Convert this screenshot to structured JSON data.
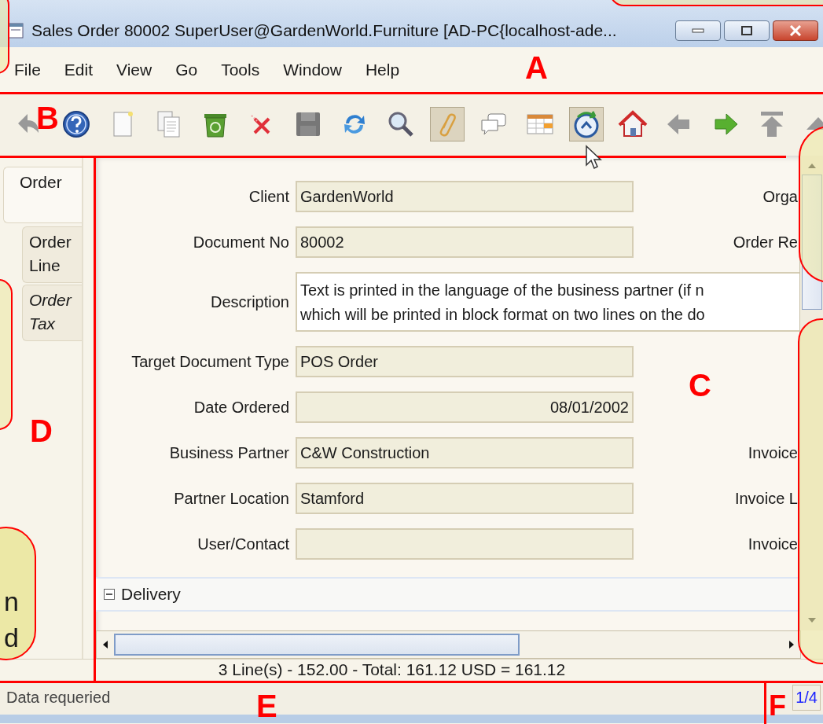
{
  "window": {
    "title": "Sales Order  80002  SuperUser@GardenWorld.Furniture [AD-PC{localhost-ade..."
  },
  "menu": [
    {
      "label": "File"
    },
    {
      "label": "Edit"
    },
    {
      "label": "View"
    },
    {
      "label": "Go"
    },
    {
      "label": "Tools"
    },
    {
      "label": "Window"
    },
    {
      "label": "Help"
    }
  ],
  "toolbar": [
    {
      "kind": "back",
      "pressed": false
    },
    {
      "kind": "help",
      "pressed": false
    },
    {
      "kind": "new",
      "pressed": false
    },
    {
      "kind": "copy",
      "pressed": false
    },
    {
      "kind": "delete",
      "pressed": false
    },
    {
      "kind": "delete-selection",
      "pressed": false
    },
    {
      "kind": "save",
      "pressed": false
    },
    {
      "kind": "refresh",
      "pressed": false
    },
    {
      "kind": "find",
      "pressed": false
    },
    {
      "kind": "attachment",
      "pressed": true
    },
    {
      "kind": "chat",
      "pressed": false
    },
    {
      "kind": "grid",
      "pressed": false
    },
    {
      "kind": "history",
      "pressed": true
    },
    {
      "kind": "home",
      "pressed": false
    },
    {
      "kind": "previous",
      "pressed": false
    },
    {
      "kind": "next",
      "pressed": false
    },
    {
      "kind": "first",
      "pressed": false
    },
    {
      "kind": "up",
      "pressed": false
    }
  ],
  "tabs": [
    {
      "label": "Order",
      "selected": true,
      "italic": false
    },
    {
      "label": "Order Line",
      "selected": false,
      "italic": false
    },
    {
      "label": "Order Tax",
      "selected": false,
      "italic": true
    }
  ],
  "fields": [
    {
      "kind": "text",
      "label": "Client",
      "value": "GardenWorld",
      "side_label": "Orga"
    },
    {
      "kind": "text",
      "label": "Document No",
      "value": "80002",
      "side_label": "Order Re"
    },
    {
      "kind": "textarea",
      "label": "Description",
      "lines": [
        "Text is printed in the language of the business partner (if n",
        "which will be printed in block format on two lines on the do"
      ]
    },
    {
      "kind": "text",
      "label": "Target Document Type",
      "value": "POS Order"
    },
    {
      "kind": "date",
      "label": "Date Ordered",
      "value": "08/01/2002"
    },
    {
      "kind": "text",
      "label": "Business Partner",
      "value": "C&W Construction",
      "side_label": "Invoice"
    },
    {
      "kind": "text",
      "label": "Partner Location",
      "value": "Stamford",
      "side_label": "Invoice L"
    },
    {
      "kind": "text",
      "label": "User/Contact",
      "side_label": "Invoice"
    }
  ],
  "section": {
    "label": "Delivery",
    "expanded": true
  },
  "totals": "3 Line(s) - 152.00 -  Total: 161.12  USD  =  161.12",
  "status_bar": {
    "message": "Data requeried",
    "record": "1/4"
  },
  "annotations": [
    {
      "letter": "A"
    },
    {
      "letter": "B"
    },
    {
      "letter": "C"
    },
    {
      "letter": "D"
    },
    {
      "letter": "E"
    },
    {
      "letter": "F"
    }
  ],
  "callout": {
    "lines": [
      "n",
      "d"
    ]
  }
}
